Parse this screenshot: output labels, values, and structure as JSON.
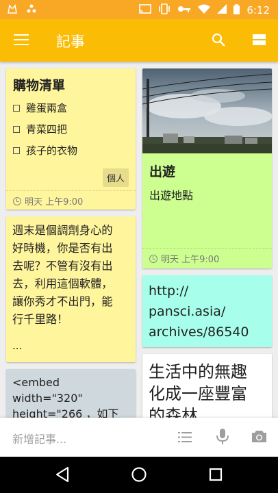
{
  "status_bar": {
    "time": "6:12",
    "left_icons": [
      "cat-icon",
      "pinwheel-icon"
    ],
    "right_icons": [
      "cast-icon",
      "vibrate-icon",
      "key-icon",
      "wifi-icon",
      "signal-icon",
      "battery-icon"
    ]
  },
  "app_bar": {
    "title": "記事",
    "icons": [
      "menu-icon",
      "search-icon",
      "layout-toggle-icon"
    ]
  },
  "notes": {
    "shopping": {
      "title": "購物清單",
      "items": [
        {
          "text": "雞蛋兩盒",
          "checked": false
        },
        {
          "text": "青菜四把",
          "checked": false
        },
        {
          "text": "孩子的衣物",
          "checked": false
        }
      ],
      "label": "個人",
      "reminder": "明天 上午9:00",
      "color": "#fff59d"
    },
    "trip": {
      "title": "出遊",
      "body": "出遊地點",
      "reminder": "明天 上午9:00",
      "color": "#ccff90"
    },
    "weekend": {
      "lines": [
        "週末是個調劑身心的",
        "好時機，你是否有出",
        "去呢？不管有沒有出",
        "去，利用這個軟體，",
        "讓你秀才不出門，能",
        "行千里路！"
      ],
      "ellipsis": "...",
      "color": "#fff59d"
    },
    "link": {
      "lines": [
        "http://",
        "pansci.asia/",
        "archives/86540"
      ],
      "color": "#a7ffeb"
    },
    "embed": {
      "lines": [
        "<embed",
        "width=\"320\"",
        "height=\"266 ，如下"
      ],
      "color": "#cfd8dc"
    },
    "life": {
      "lines": [
        "生活中的無趣",
        "化成一座豐富",
        "的森林"
      ],
      "color": "#ffffff"
    }
  },
  "bottom_bar": {
    "placeholder": "新增記事...",
    "icons": [
      "list-icon",
      "mic-icon",
      "camera-icon"
    ]
  },
  "nav_bar": {
    "icons": [
      "back-icon",
      "home-icon",
      "recents-icon"
    ]
  }
}
